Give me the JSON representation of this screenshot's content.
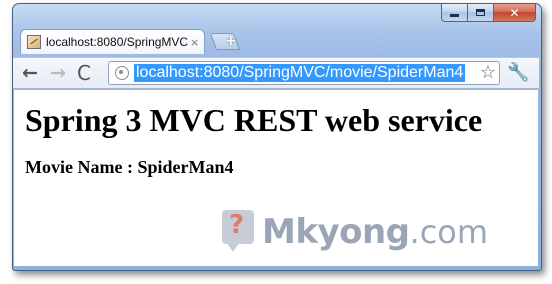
{
  "window": {
    "minimize_icon": "minimize-icon",
    "maximize_icon": "maximize-icon",
    "close_icon": "close-icon",
    "close_label": "✕"
  },
  "tab": {
    "title": "localhost:8080/SpringMVC/",
    "close_label": "×"
  },
  "new_tab": {
    "label": "+"
  },
  "toolbar": {
    "back_label": "←",
    "forward_label": "→",
    "reload_label": "C",
    "url": "localhost:8080/SpringMVC/movie/SpiderMan4",
    "star_label": "☆",
    "wrench_label": "🔧"
  },
  "page": {
    "heading": "Spring 3 MVC REST web service",
    "movie_line": "Movie Name : SpiderMan4"
  },
  "watermark": {
    "question": "?",
    "brand": "Mkyong",
    "suffix": ".com"
  },
  "colors": {
    "selection": "#3399ff",
    "frame": "#a9c4ea",
    "close_button": "#c2452b"
  }
}
